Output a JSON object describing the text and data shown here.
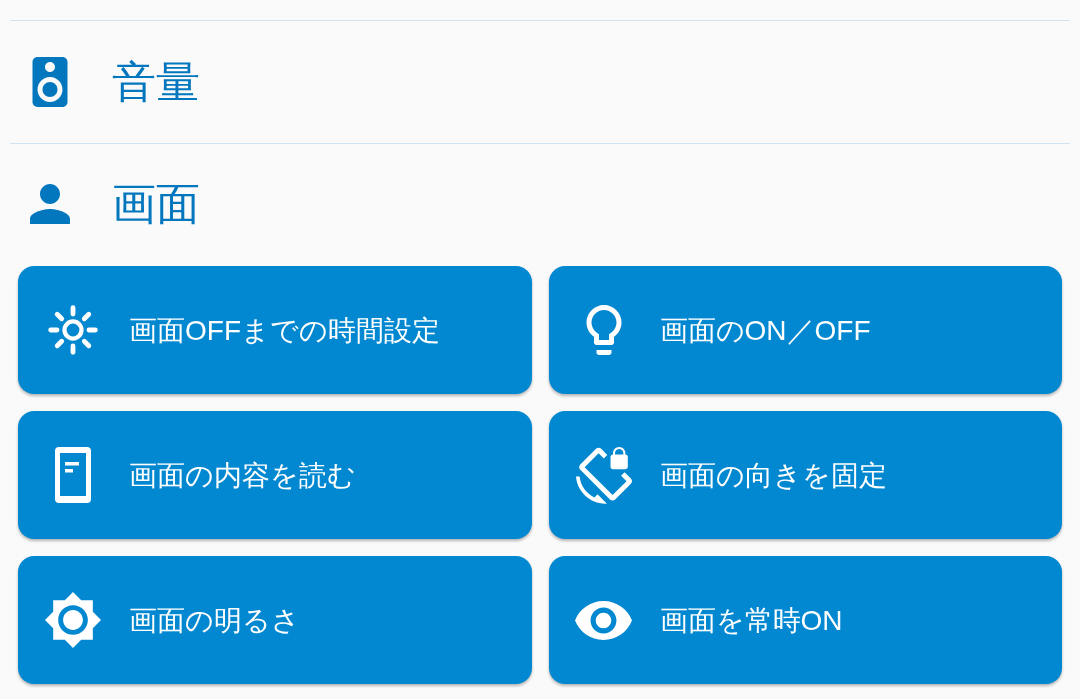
{
  "sections": [
    {
      "title": "音量"
    },
    {
      "title": "画面",
      "buttons": [
        {
          "label": "画面OFFまでの時間設定"
        },
        {
          "label": "画面のON／OFF"
        },
        {
          "label": "画面の内容を読む"
        },
        {
          "label": "画面の向きを固定"
        },
        {
          "label": "画面の明るさ"
        },
        {
          "label": "画面を常時ON"
        }
      ]
    }
  ]
}
